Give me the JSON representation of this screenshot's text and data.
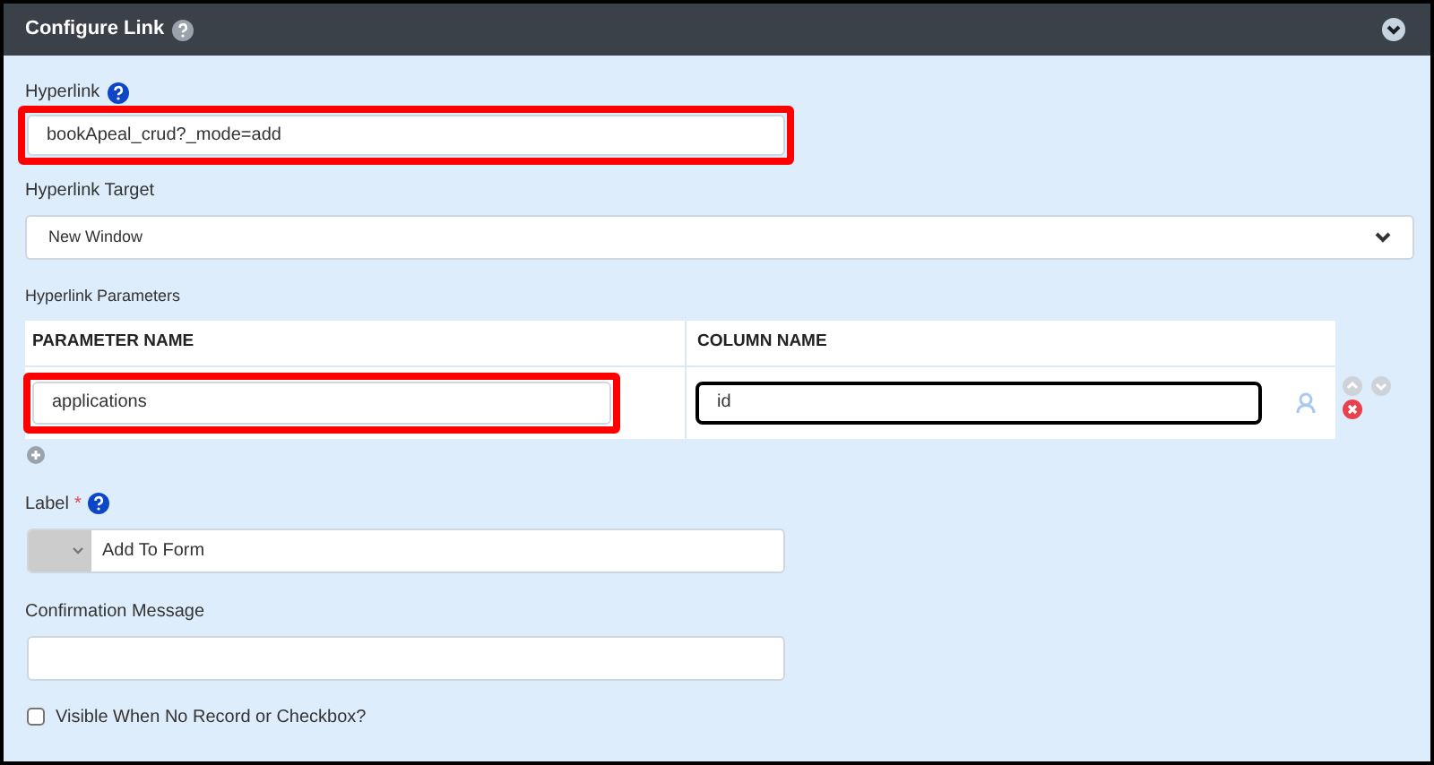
{
  "panel": {
    "title": "Configure Link",
    "expanded": true
  },
  "hyperlink": {
    "label": "Hyperlink",
    "value": "bookApeal_crud?_mode=add",
    "highlighted": true
  },
  "hyperlink_target": {
    "label": "Hyperlink Target",
    "value": "New Window"
  },
  "hyperlink_parameters": {
    "label": "Hyperlink Parameters",
    "columns": [
      "PARAMETER NAME",
      "COLUMN NAME"
    ],
    "rows": [
      {
        "parameter_name": "applications",
        "column_name": "id",
        "parameter_highlighted": true,
        "column_focused": true
      }
    ]
  },
  "label_field": {
    "label": "Label",
    "required_mark": "*",
    "value": "Add To Form"
  },
  "confirmation_message": {
    "label": "Confirmation Message"
  },
  "visible_checkbox": {
    "label": "Visible When No Record or Checkbox?",
    "checked": false
  }
}
